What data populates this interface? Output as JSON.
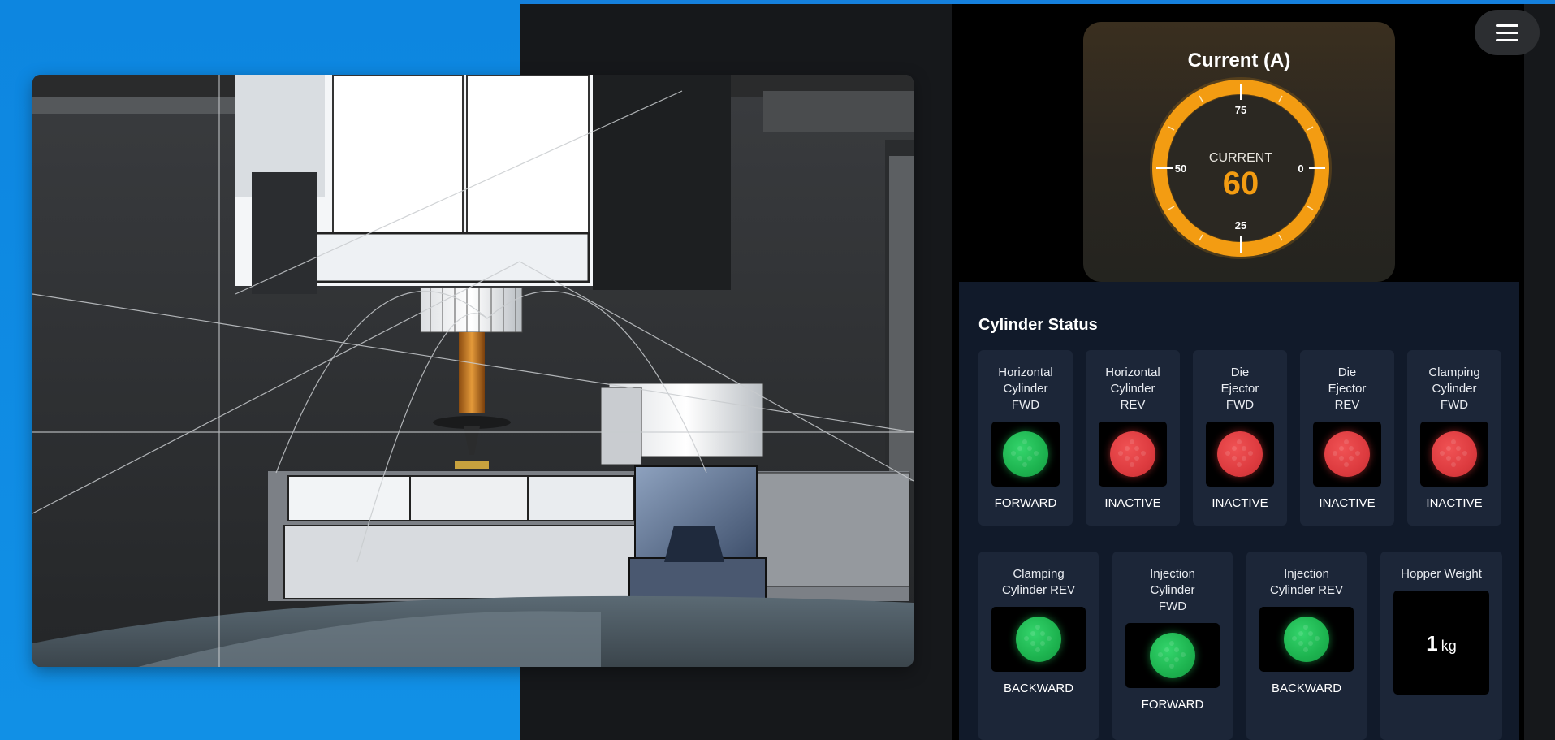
{
  "gauge": {
    "title": "Current (A)",
    "caption": "CURRENT",
    "value": "60",
    "tick_top": "75",
    "tick_left": "50",
    "tick_right": "0",
    "tick_bottom": "25",
    "accent": "#f39c12"
  },
  "cylinders": {
    "title": "Cylinder Status",
    "row1": [
      {
        "label": "Horizontal Cylinder FWD",
        "state": "FORWARD",
        "color": "green"
      },
      {
        "label": "Horizontal Cylinder REV",
        "state": "INACTIVE",
        "color": "red"
      },
      {
        "label": "Die Ejector FWD",
        "state": "INACTIVE",
        "color": "red"
      },
      {
        "label": "Die Ejector REV",
        "state": "INACTIVE",
        "color": "red"
      },
      {
        "label": "Clamping Cylinder FWD",
        "state": "INACTIVE",
        "color": "red"
      }
    ],
    "row2": [
      {
        "label": "Clamping Cylinder REV",
        "state": "BACKWARD",
        "color": "green"
      },
      {
        "label": "Injection Cylinder FWD",
        "state": "FORWARD",
        "color": "green"
      },
      {
        "label": "Injection Cylinder REV",
        "state": "BACKWARD",
        "color": "green"
      }
    ],
    "hopper": {
      "label": "Hopper Weight",
      "value": "1",
      "unit": "kg"
    }
  },
  "colors": {
    "green": "#1db34f",
    "red": "#dd3b3f",
    "panel": "#111a2a",
    "card": "#1c2638"
  }
}
